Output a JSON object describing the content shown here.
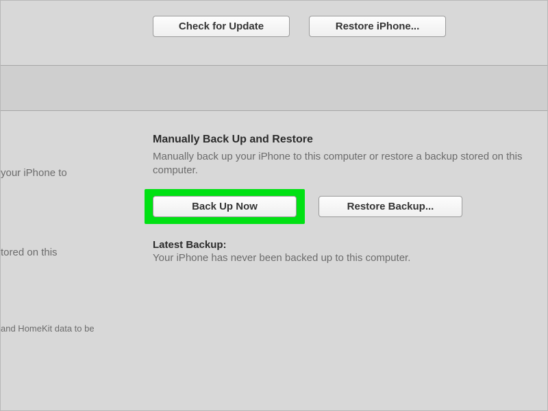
{
  "top": {
    "check_update_label": "Check for Update",
    "restore_iphone_label": "Restore iPhone..."
  },
  "manual": {
    "heading": "Manually Back Up and Restore",
    "description": "Manually back up your iPhone to this computer or restore a backup stored on this computer.",
    "back_up_now_label": "Back Up Now",
    "restore_backup_label": "Restore Backup..."
  },
  "latest": {
    "label": "Latest Backup:",
    "status": "Your iPhone has never been backed up to this computer."
  },
  "side_fragments": {
    "line1": "your iPhone to",
    "line2": "tored on this",
    "line3": "and HomeKit data to be"
  }
}
